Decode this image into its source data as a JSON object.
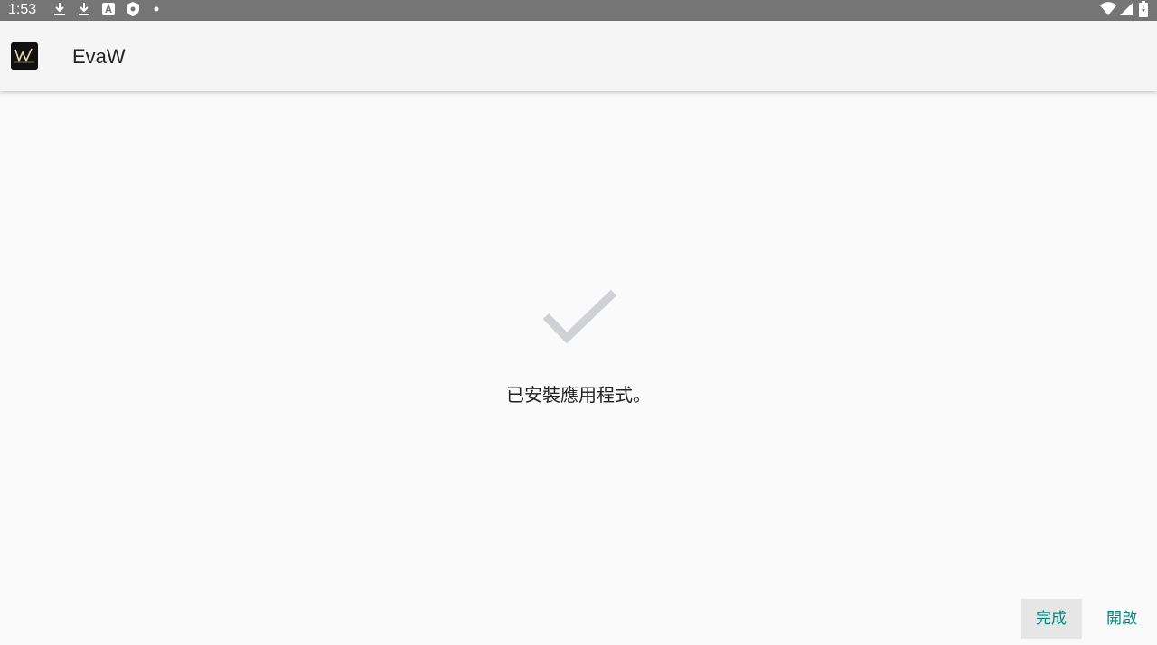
{
  "status_bar": {
    "time": "1:53",
    "left_icons": [
      "download-icon",
      "download-icon",
      "app-store-icon",
      "shield-icon",
      "dot-icon"
    ],
    "right_icons": [
      "wifi-icon",
      "signal-icon",
      "battery-icon"
    ]
  },
  "app_bar": {
    "icon": "app-logo-icon",
    "title": "EvaW"
  },
  "main": {
    "status_icon": "checkmark-icon",
    "message": "已安裝應用程式。"
  },
  "actions": {
    "done_label": "完成",
    "open_label": "開啟"
  },
  "colors": {
    "accent": "#00897b",
    "status_bar": "#757575",
    "check": "#cfd1d4"
  }
}
